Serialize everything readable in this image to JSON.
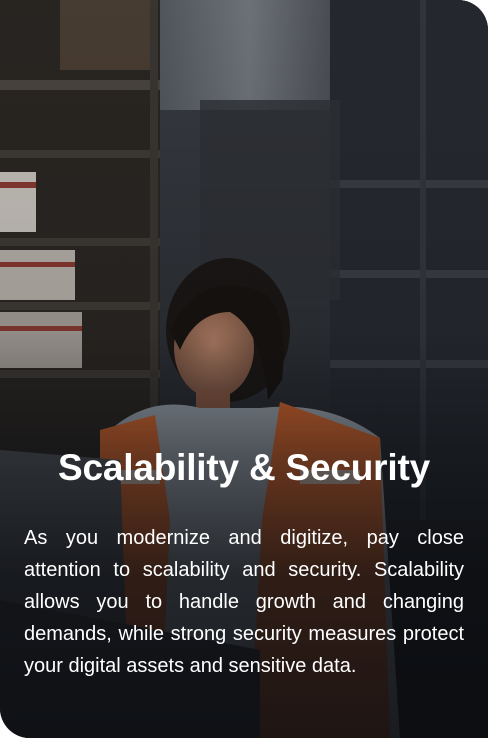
{
  "card": {
    "title": "Scalability & Security",
    "description": "As you modernize and digitize, pay close attention to scalability and security. Scalability allows you to handle growth and changing demands, while strong security measures protect your digital assets and sensitive data."
  },
  "image": {
    "subject": "warehouse-worker-photo"
  },
  "colors": {
    "text": "#ffffff",
    "vest": "#d9682e",
    "background": "#1f2126"
  }
}
